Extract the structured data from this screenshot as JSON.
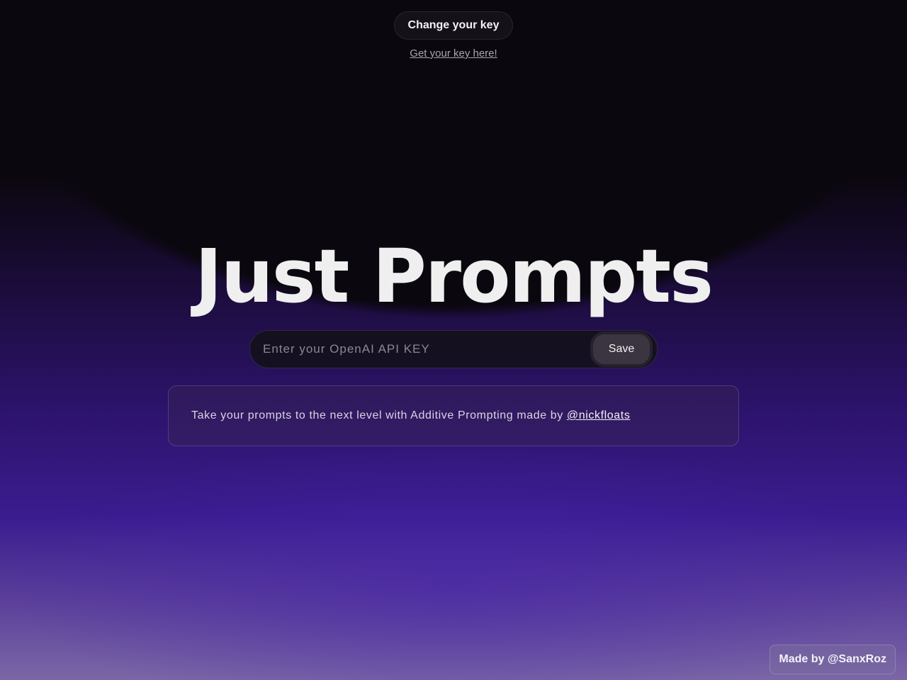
{
  "header": {
    "change_key_label": "Change your key",
    "get_key_link": "Get your key here!"
  },
  "hero": {
    "title": "Just Prompts"
  },
  "key_form": {
    "placeholder": "Enter your OpenAI API KEY",
    "value": "",
    "save_label": "Save"
  },
  "info": {
    "text": "Take your prompts to the next level with Additive Prompting made by",
    "link_text": "@nickfloats"
  },
  "footer": {
    "credit": "Made by @SanxRoz"
  },
  "colors": {
    "background_top": "#0b070f",
    "background_mid": "#3b1c8f",
    "background_bottom": "#7b67a6",
    "title": "#efefef"
  }
}
